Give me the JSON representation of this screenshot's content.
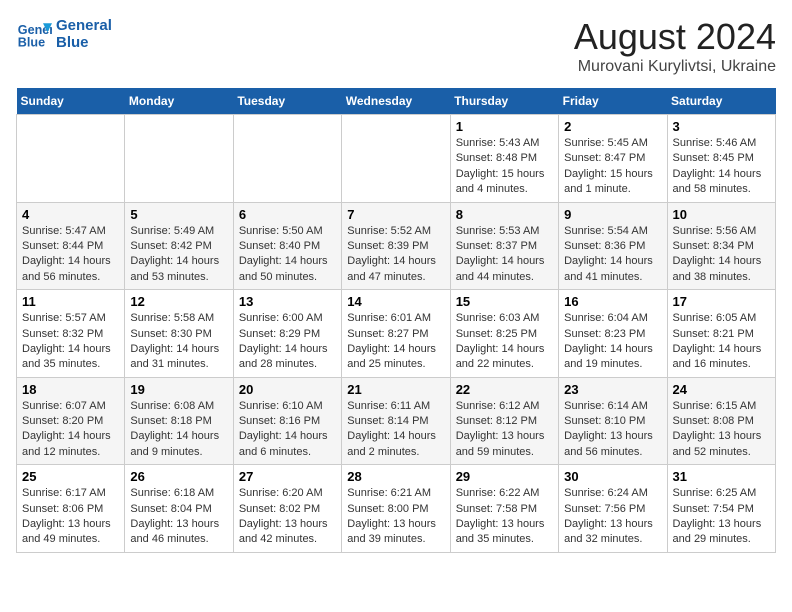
{
  "header": {
    "logo_line1": "General",
    "logo_line2": "Blue",
    "title": "August 2024",
    "subtitle": "Murovani Kurylivtsi, Ukraine"
  },
  "weekdays": [
    "Sunday",
    "Monday",
    "Tuesday",
    "Wednesday",
    "Thursday",
    "Friday",
    "Saturday"
  ],
  "weeks": [
    [
      {
        "day": "",
        "info": ""
      },
      {
        "day": "",
        "info": ""
      },
      {
        "day": "",
        "info": ""
      },
      {
        "day": "",
        "info": ""
      },
      {
        "day": "1",
        "info": "Sunrise: 5:43 AM\nSunset: 8:48 PM\nDaylight: 15 hours and 4 minutes."
      },
      {
        "day": "2",
        "info": "Sunrise: 5:45 AM\nSunset: 8:47 PM\nDaylight: 15 hours and 1 minute."
      },
      {
        "day": "3",
        "info": "Sunrise: 5:46 AM\nSunset: 8:45 PM\nDaylight: 14 hours and 58 minutes."
      }
    ],
    [
      {
        "day": "4",
        "info": "Sunrise: 5:47 AM\nSunset: 8:44 PM\nDaylight: 14 hours and 56 minutes."
      },
      {
        "day": "5",
        "info": "Sunrise: 5:49 AM\nSunset: 8:42 PM\nDaylight: 14 hours and 53 minutes."
      },
      {
        "day": "6",
        "info": "Sunrise: 5:50 AM\nSunset: 8:40 PM\nDaylight: 14 hours and 50 minutes."
      },
      {
        "day": "7",
        "info": "Sunrise: 5:52 AM\nSunset: 8:39 PM\nDaylight: 14 hours and 47 minutes."
      },
      {
        "day": "8",
        "info": "Sunrise: 5:53 AM\nSunset: 8:37 PM\nDaylight: 14 hours and 44 minutes."
      },
      {
        "day": "9",
        "info": "Sunrise: 5:54 AM\nSunset: 8:36 PM\nDaylight: 14 hours and 41 minutes."
      },
      {
        "day": "10",
        "info": "Sunrise: 5:56 AM\nSunset: 8:34 PM\nDaylight: 14 hours and 38 minutes."
      }
    ],
    [
      {
        "day": "11",
        "info": "Sunrise: 5:57 AM\nSunset: 8:32 PM\nDaylight: 14 hours and 35 minutes."
      },
      {
        "day": "12",
        "info": "Sunrise: 5:58 AM\nSunset: 8:30 PM\nDaylight: 14 hours and 31 minutes."
      },
      {
        "day": "13",
        "info": "Sunrise: 6:00 AM\nSunset: 8:29 PM\nDaylight: 14 hours and 28 minutes."
      },
      {
        "day": "14",
        "info": "Sunrise: 6:01 AM\nSunset: 8:27 PM\nDaylight: 14 hours and 25 minutes."
      },
      {
        "day": "15",
        "info": "Sunrise: 6:03 AM\nSunset: 8:25 PM\nDaylight: 14 hours and 22 minutes."
      },
      {
        "day": "16",
        "info": "Sunrise: 6:04 AM\nSunset: 8:23 PM\nDaylight: 14 hours and 19 minutes."
      },
      {
        "day": "17",
        "info": "Sunrise: 6:05 AM\nSunset: 8:21 PM\nDaylight: 14 hours and 16 minutes."
      }
    ],
    [
      {
        "day": "18",
        "info": "Sunrise: 6:07 AM\nSunset: 8:20 PM\nDaylight: 14 hours and 12 minutes."
      },
      {
        "day": "19",
        "info": "Sunrise: 6:08 AM\nSunset: 8:18 PM\nDaylight: 14 hours and 9 minutes."
      },
      {
        "day": "20",
        "info": "Sunrise: 6:10 AM\nSunset: 8:16 PM\nDaylight: 14 hours and 6 minutes."
      },
      {
        "day": "21",
        "info": "Sunrise: 6:11 AM\nSunset: 8:14 PM\nDaylight: 14 hours and 2 minutes."
      },
      {
        "day": "22",
        "info": "Sunrise: 6:12 AM\nSunset: 8:12 PM\nDaylight: 13 hours and 59 minutes."
      },
      {
        "day": "23",
        "info": "Sunrise: 6:14 AM\nSunset: 8:10 PM\nDaylight: 13 hours and 56 minutes."
      },
      {
        "day": "24",
        "info": "Sunrise: 6:15 AM\nSunset: 8:08 PM\nDaylight: 13 hours and 52 minutes."
      }
    ],
    [
      {
        "day": "25",
        "info": "Sunrise: 6:17 AM\nSunset: 8:06 PM\nDaylight: 13 hours and 49 minutes."
      },
      {
        "day": "26",
        "info": "Sunrise: 6:18 AM\nSunset: 8:04 PM\nDaylight: 13 hours and 46 minutes."
      },
      {
        "day": "27",
        "info": "Sunrise: 6:20 AM\nSunset: 8:02 PM\nDaylight: 13 hours and 42 minutes."
      },
      {
        "day": "28",
        "info": "Sunrise: 6:21 AM\nSunset: 8:00 PM\nDaylight: 13 hours and 39 minutes."
      },
      {
        "day": "29",
        "info": "Sunrise: 6:22 AM\nSunset: 7:58 PM\nDaylight: 13 hours and 35 minutes."
      },
      {
        "day": "30",
        "info": "Sunrise: 6:24 AM\nSunset: 7:56 PM\nDaylight: 13 hours and 32 minutes."
      },
      {
        "day": "31",
        "info": "Sunrise: 6:25 AM\nSunset: 7:54 PM\nDaylight: 13 hours and 29 minutes."
      }
    ]
  ]
}
